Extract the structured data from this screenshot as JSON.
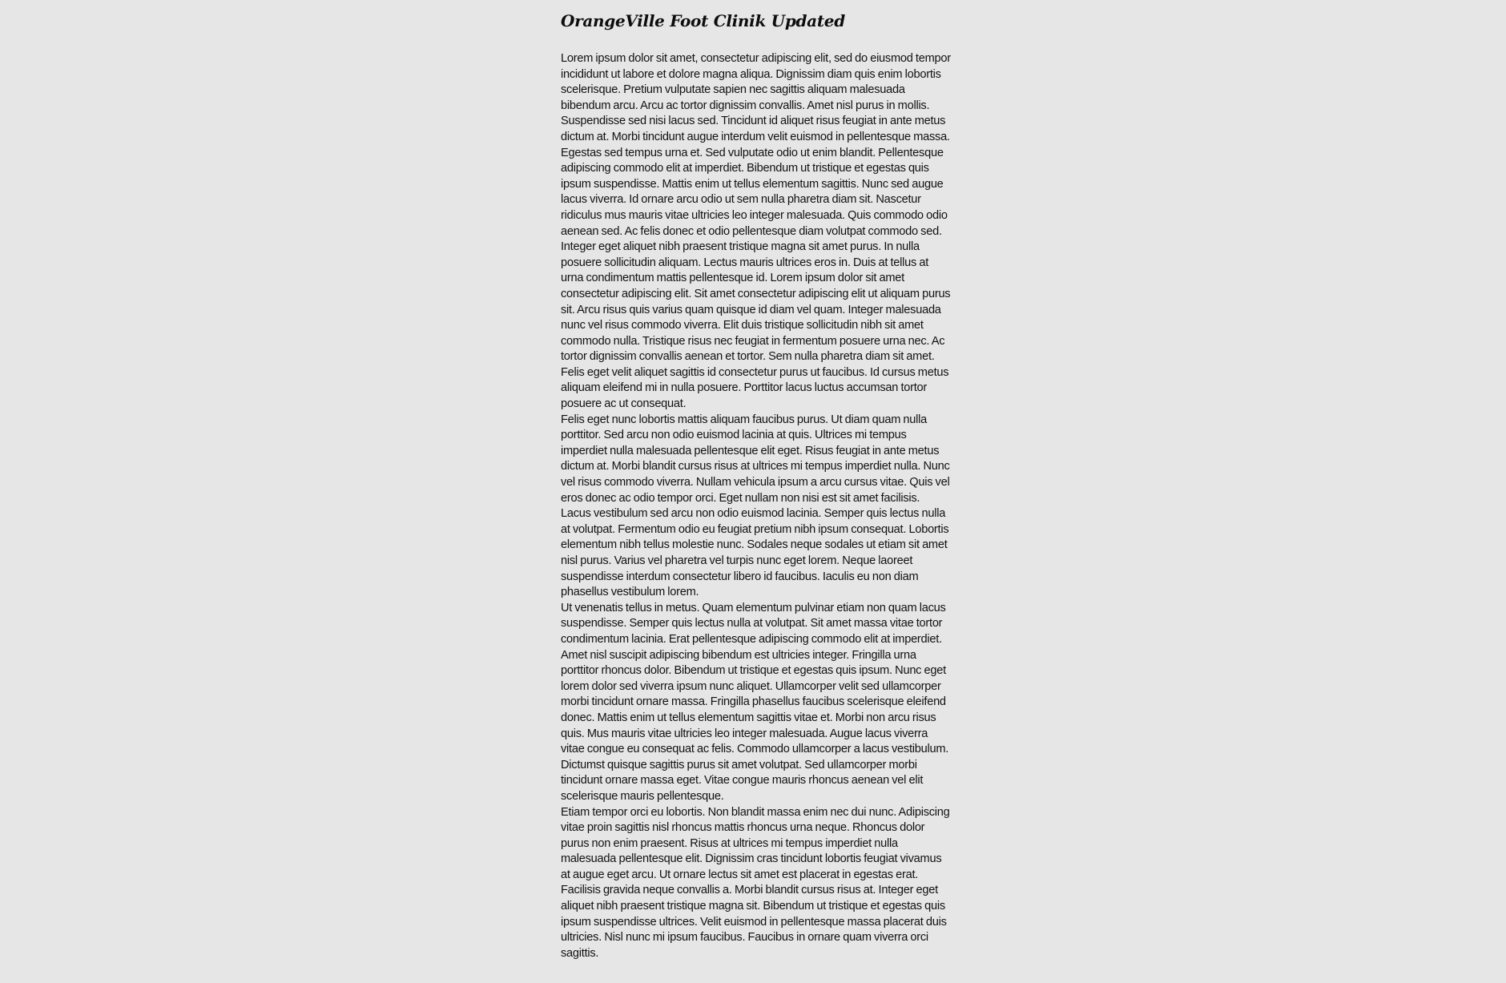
{
  "article": {
    "title": "OrangeVille Foot Clinik Updated",
    "paragraphs": [
      "Lorem ipsum dolor sit amet, consectetur adipiscing elit, sed do eiusmod tempor incididunt ut labore et dolore magna aliqua. Dignissim diam quis enim lobortis scelerisque. Pretium vulputate sapien nec sagittis aliquam malesuada bibendum arcu. Arcu ac tortor dignissim convallis. Amet nisl purus in mollis. Suspendisse sed nisi lacus sed. Tincidunt id aliquet risus feugiat in ante metus dictum at. Morbi tincidunt augue interdum velit euismod in pellentesque massa. Egestas sed tempus urna et. Sed vulputate odio ut enim blandit. Pellentesque adipiscing commodo elit at imperdiet. Bibendum ut tristique et egestas quis ipsum suspendisse. Mattis enim ut tellus elementum sagittis. Nunc sed augue lacus viverra. Id ornare arcu odio ut sem nulla pharetra diam sit. Nascetur ridiculus mus mauris vitae ultricies leo integer malesuada. Quis commodo odio aenean sed. Ac felis donec et odio pellentesque diam volutpat commodo sed.",
      "Integer eget aliquet nibh praesent tristique magna sit amet purus. In nulla posuere sollicitudin aliquam. Lectus mauris ultrices eros in. Duis at tellus at urna condimentum mattis pellentesque id. Lorem ipsum dolor sit amet consectetur adipiscing elit. Sit amet consectetur adipiscing elit ut aliquam purus sit. Arcu risus quis varius quam quisque id diam vel quam. Integer malesuada nunc vel risus commodo viverra. Elit duis tristique sollicitudin nibh sit amet commodo nulla. Tristique risus nec feugiat in fermentum posuere urna nec. Ac tortor dignissim convallis aenean et tortor. Sem nulla pharetra diam sit amet. Felis eget velit aliquet sagittis id consectetur purus ut faucibus. Id cursus metus aliquam eleifend mi in nulla posuere. Porttitor lacus luctus accumsan tortor posuere ac ut consequat.",
      "Felis eget nunc lobortis mattis aliquam faucibus purus. Ut diam quam nulla porttitor. Sed arcu non odio euismod lacinia at quis. Ultrices mi tempus imperdiet nulla malesuada pellentesque elit eget. Risus feugiat in ante metus dictum at. Morbi blandit cursus risus at ultrices mi tempus imperdiet nulla. Nunc vel risus commodo viverra. Nullam vehicula ipsum a arcu cursus vitae. Quis vel eros donec ac odio tempor orci. Eget nullam non nisi est sit amet facilisis. Lacus vestibulum sed arcu non odio euismod lacinia. Semper quis lectus nulla at volutpat. Fermentum odio eu feugiat pretium nibh ipsum consequat. Lobortis elementum nibh tellus molestie nunc. Sodales neque sodales ut etiam sit amet nisl purus. Varius vel pharetra vel turpis nunc eget lorem. Neque laoreet suspendisse interdum consectetur libero id faucibus. Iaculis eu non diam phasellus vestibulum lorem.",
      "Ut venenatis tellus in metus. Quam elementum pulvinar etiam non quam lacus suspendisse. Semper quis lectus nulla at volutpat. Sit amet massa vitae tortor condimentum lacinia. Erat pellentesque adipiscing commodo elit at imperdiet. Amet nisl suscipit adipiscing bibendum est ultricies integer. Fringilla urna porttitor rhoncus dolor. Bibendum ut tristique et egestas quis ipsum. Nunc eget lorem dolor sed viverra ipsum nunc aliquet. Ullamcorper velit sed ullamcorper morbi tincidunt ornare massa. Fringilla phasellus faucibus scelerisque eleifend donec. Mattis enim ut tellus elementum sagittis vitae et. Morbi non arcu risus quis. Mus mauris vitae ultricies leo integer malesuada. Augue lacus viverra vitae congue eu consequat ac felis. Commodo ullamcorper a lacus vestibulum. Dictumst quisque sagittis purus sit amet volutpat. Sed ullamcorper morbi tincidunt ornare massa eget. Vitae congue mauris rhoncus aenean vel elit scelerisque mauris pellentesque.",
      "Etiam tempor orci eu lobortis. Non blandit massa enim nec dui nunc. Adipiscing vitae proin sagittis nisl rhoncus mattis rhoncus urna neque. Rhoncus dolor purus non enim praesent. Risus at ultrices mi tempus imperdiet nulla malesuada pellentesque elit. Dignissim cras tincidunt lobortis feugiat vivamus at augue eget arcu. Ut ornare lectus sit amet est placerat in egestas erat. Facilisis gravida neque convallis a. Morbi blandit cursus risus at. Integer eget aliquet nibh praesent tristique magna sit. Bibendum ut tristique et egestas quis ipsum suspendisse ultrices. Velit euismod in pellentesque massa placerat duis ultricies. Nisl nunc mi ipsum faucibus. Faucibus in ornare quam viverra orci sagittis."
    ]
  },
  "colors": {
    "page_background": "#e6e6e6",
    "text": "#111111"
  }
}
